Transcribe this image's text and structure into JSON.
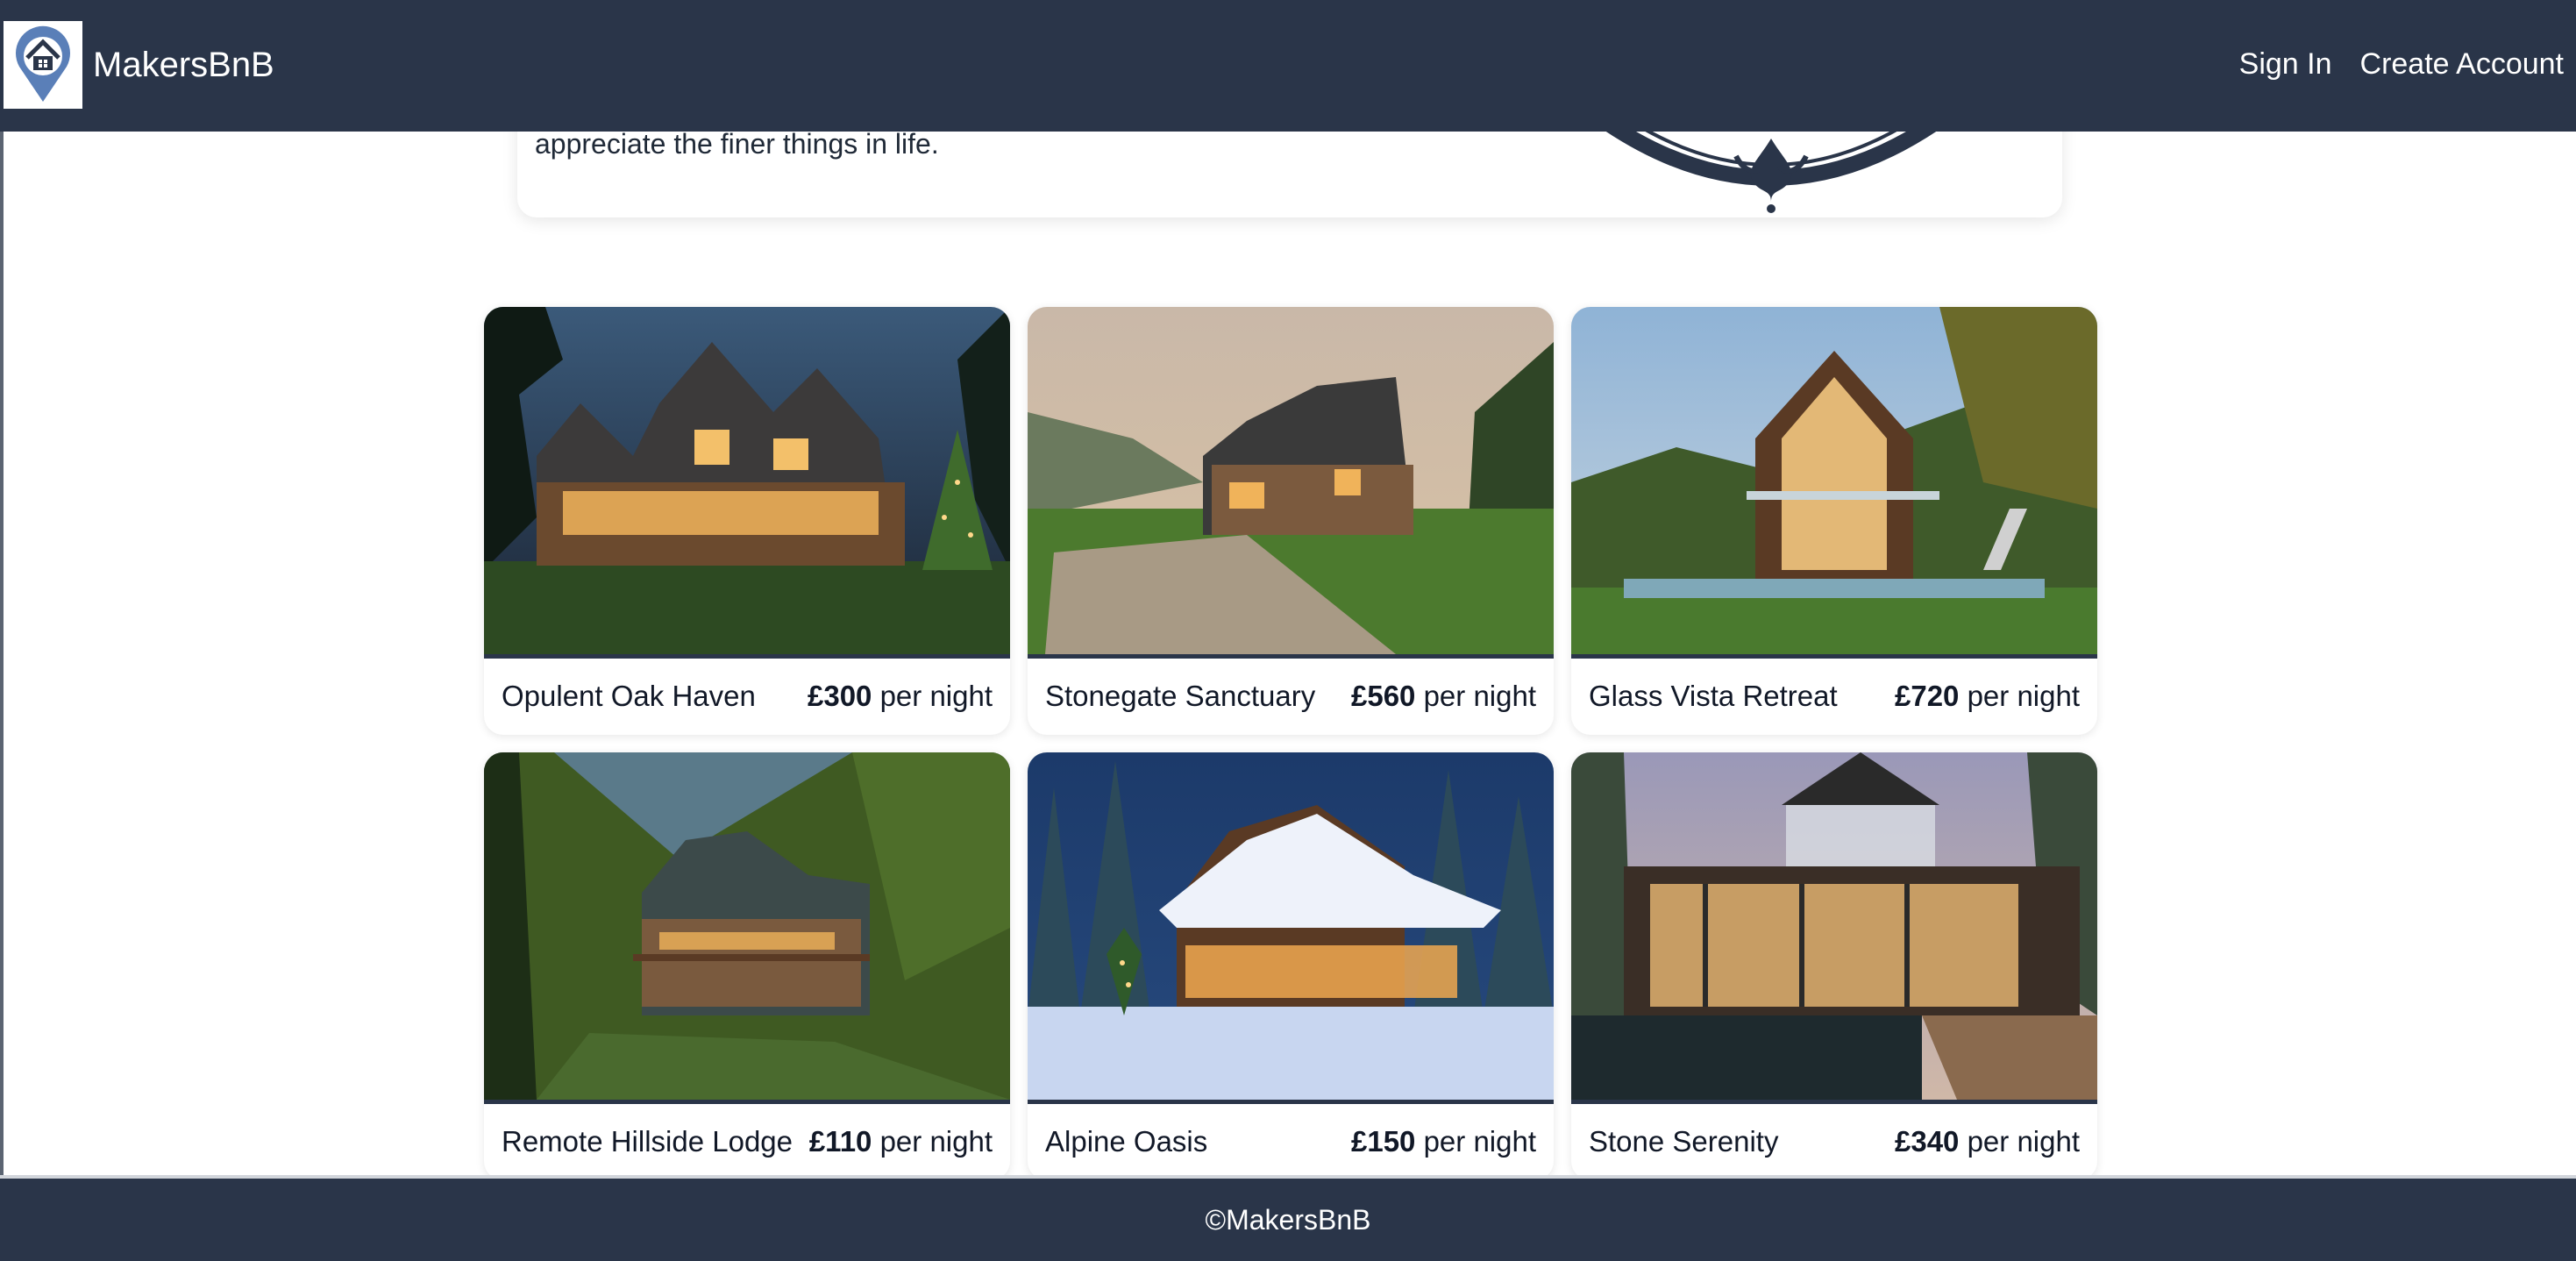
{
  "brand": {
    "name": "MakersBnB"
  },
  "nav": {
    "sign_in": "Sign In",
    "create_account": "Create Account"
  },
  "hero": {
    "text_fragment": "appreciate the finer things in life."
  },
  "listings": [
    {
      "name": "Opulent Oak Haven",
      "price": "£300",
      "unit": " per night"
    },
    {
      "name": "Stonegate Sanctuary",
      "price": "£560",
      "unit": " per night"
    },
    {
      "name": "Glass Vista Retreat",
      "price": "£720",
      "unit": " per night"
    },
    {
      "name": "Remote Hillside Lodge",
      "price": "£110",
      "unit": " per night"
    },
    {
      "name": "Alpine Oasis",
      "price": "£150",
      "unit": " per night"
    },
    {
      "name": "Stone Serenity",
      "price": "£340",
      "unit": " per night"
    }
  ],
  "footer": {
    "text": "©MakersBnB"
  },
  "colors": {
    "navbar": "#2a3549",
    "background": "#ffffff"
  }
}
